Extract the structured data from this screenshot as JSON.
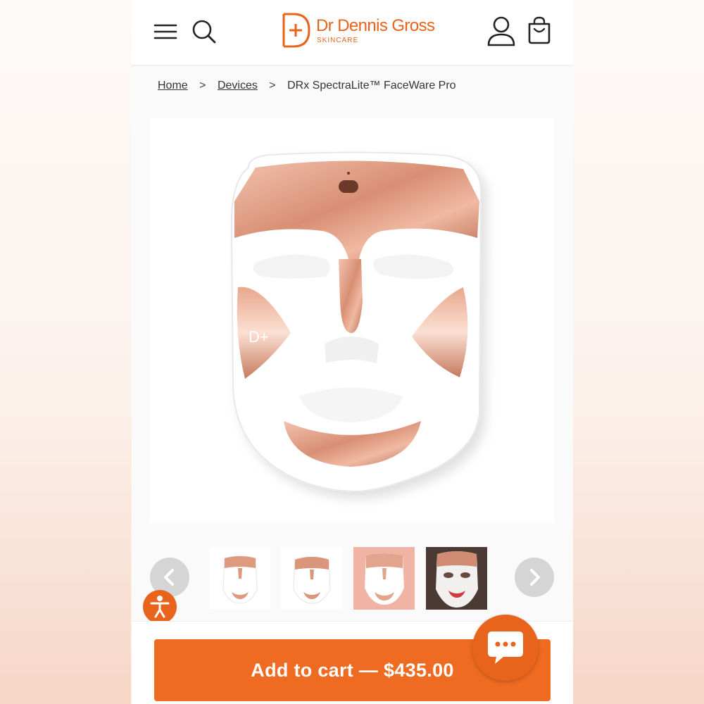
{
  "header": {
    "brand_name": "Dr Dennis Gross",
    "brand_tagline": "SKINCARE",
    "icons": [
      "menu-icon",
      "search-icon",
      "account-icon",
      "cart-icon"
    ]
  },
  "breadcrumb": {
    "items": [
      "Home",
      "Devices"
    ],
    "current": "DRx SpectraLite™ FaceWare Pro",
    "separator": ">"
  },
  "product": {
    "image_icon": "led-face-mask",
    "thumbnail_count": 4
  },
  "cart": {
    "button_label": "Add to cart — $435.00"
  },
  "colors": {
    "brand": "#e8631c",
    "cart_button": "#ee6b21",
    "rose_gold": "#e0a088",
    "carousel_arrow": "#d5d5d5"
  }
}
